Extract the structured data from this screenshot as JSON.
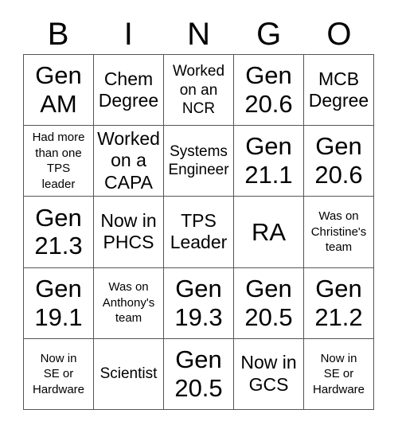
{
  "card": {
    "title_letters": [
      "B",
      "I",
      "N",
      "G",
      "O"
    ],
    "border_color": "#555555",
    "text_color": "#000000",
    "background_color": "#ffffff",
    "columns": 5,
    "rows": 5,
    "cells": [
      {
        "text": "Gen\nAM",
        "size": "xl"
      },
      {
        "text": "Chem\nDegree",
        "size": "lg"
      },
      {
        "text": "Worked\non an\nNCR",
        "size": "md"
      },
      {
        "text": "Gen\n20.6",
        "size": "xl"
      },
      {
        "text": "MCB\nDegree",
        "size": "lg"
      },
      {
        "text": "Had more\nthan one\nTPS\nleader",
        "size": "sm"
      },
      {
        "text": "Worked\non a\nCAPA",
        "size": "lg"
      },
      {
        "text": "Systems\nEngineer",
        "size": "md"
      },
      {
        "text": "Gen\n21.1",
        "size": "xl"
      },
      {
        "text": "Gen\n20.6",
        "size": "xl"
      },
      {
        "text": "Gen\n21.3",
        "size": "xl"
      },
      {
        "text": "Now in\nPHCS",
        "size": "lg"
      },
      {
        "text": "TPS\nLeader",
        "size": "lg"
      },
      {
        "text": "RA",
        "size": "xl"
      },
      {
        "text": "Was on\nChristine's\nteam",
        "size": "sm"
      },
      {
        "text": "Gen\n19.1",
        "size": "xl"
      },
      {
        "text": "Was on\nAnthony's\nteam",
        "size": "sm"
      },
      {
        "text": "Gen\n19.3",
        "size": "xl"
      },
      {
        "text": "Gen\n20.5",
        "size": "xl"
      },
      {
        "text": "Gen\n21.2",
        "size": "xl"
      },
      {
        "text": "Now in\nSE or\nHardware",
        "size": "sm"
      },
      {
        "text": "Scientist",
        "size": "md"
      },
      {
        "text": "Gen\n20.5",
        "size": "xl"
      },
      {
        "text": "Now in\nGCS",
        "size": "lg"
      },
      {
        "text": "Now in\nSE or\nHardware",
        "size": "sm"
      }
    ]
  }
}
